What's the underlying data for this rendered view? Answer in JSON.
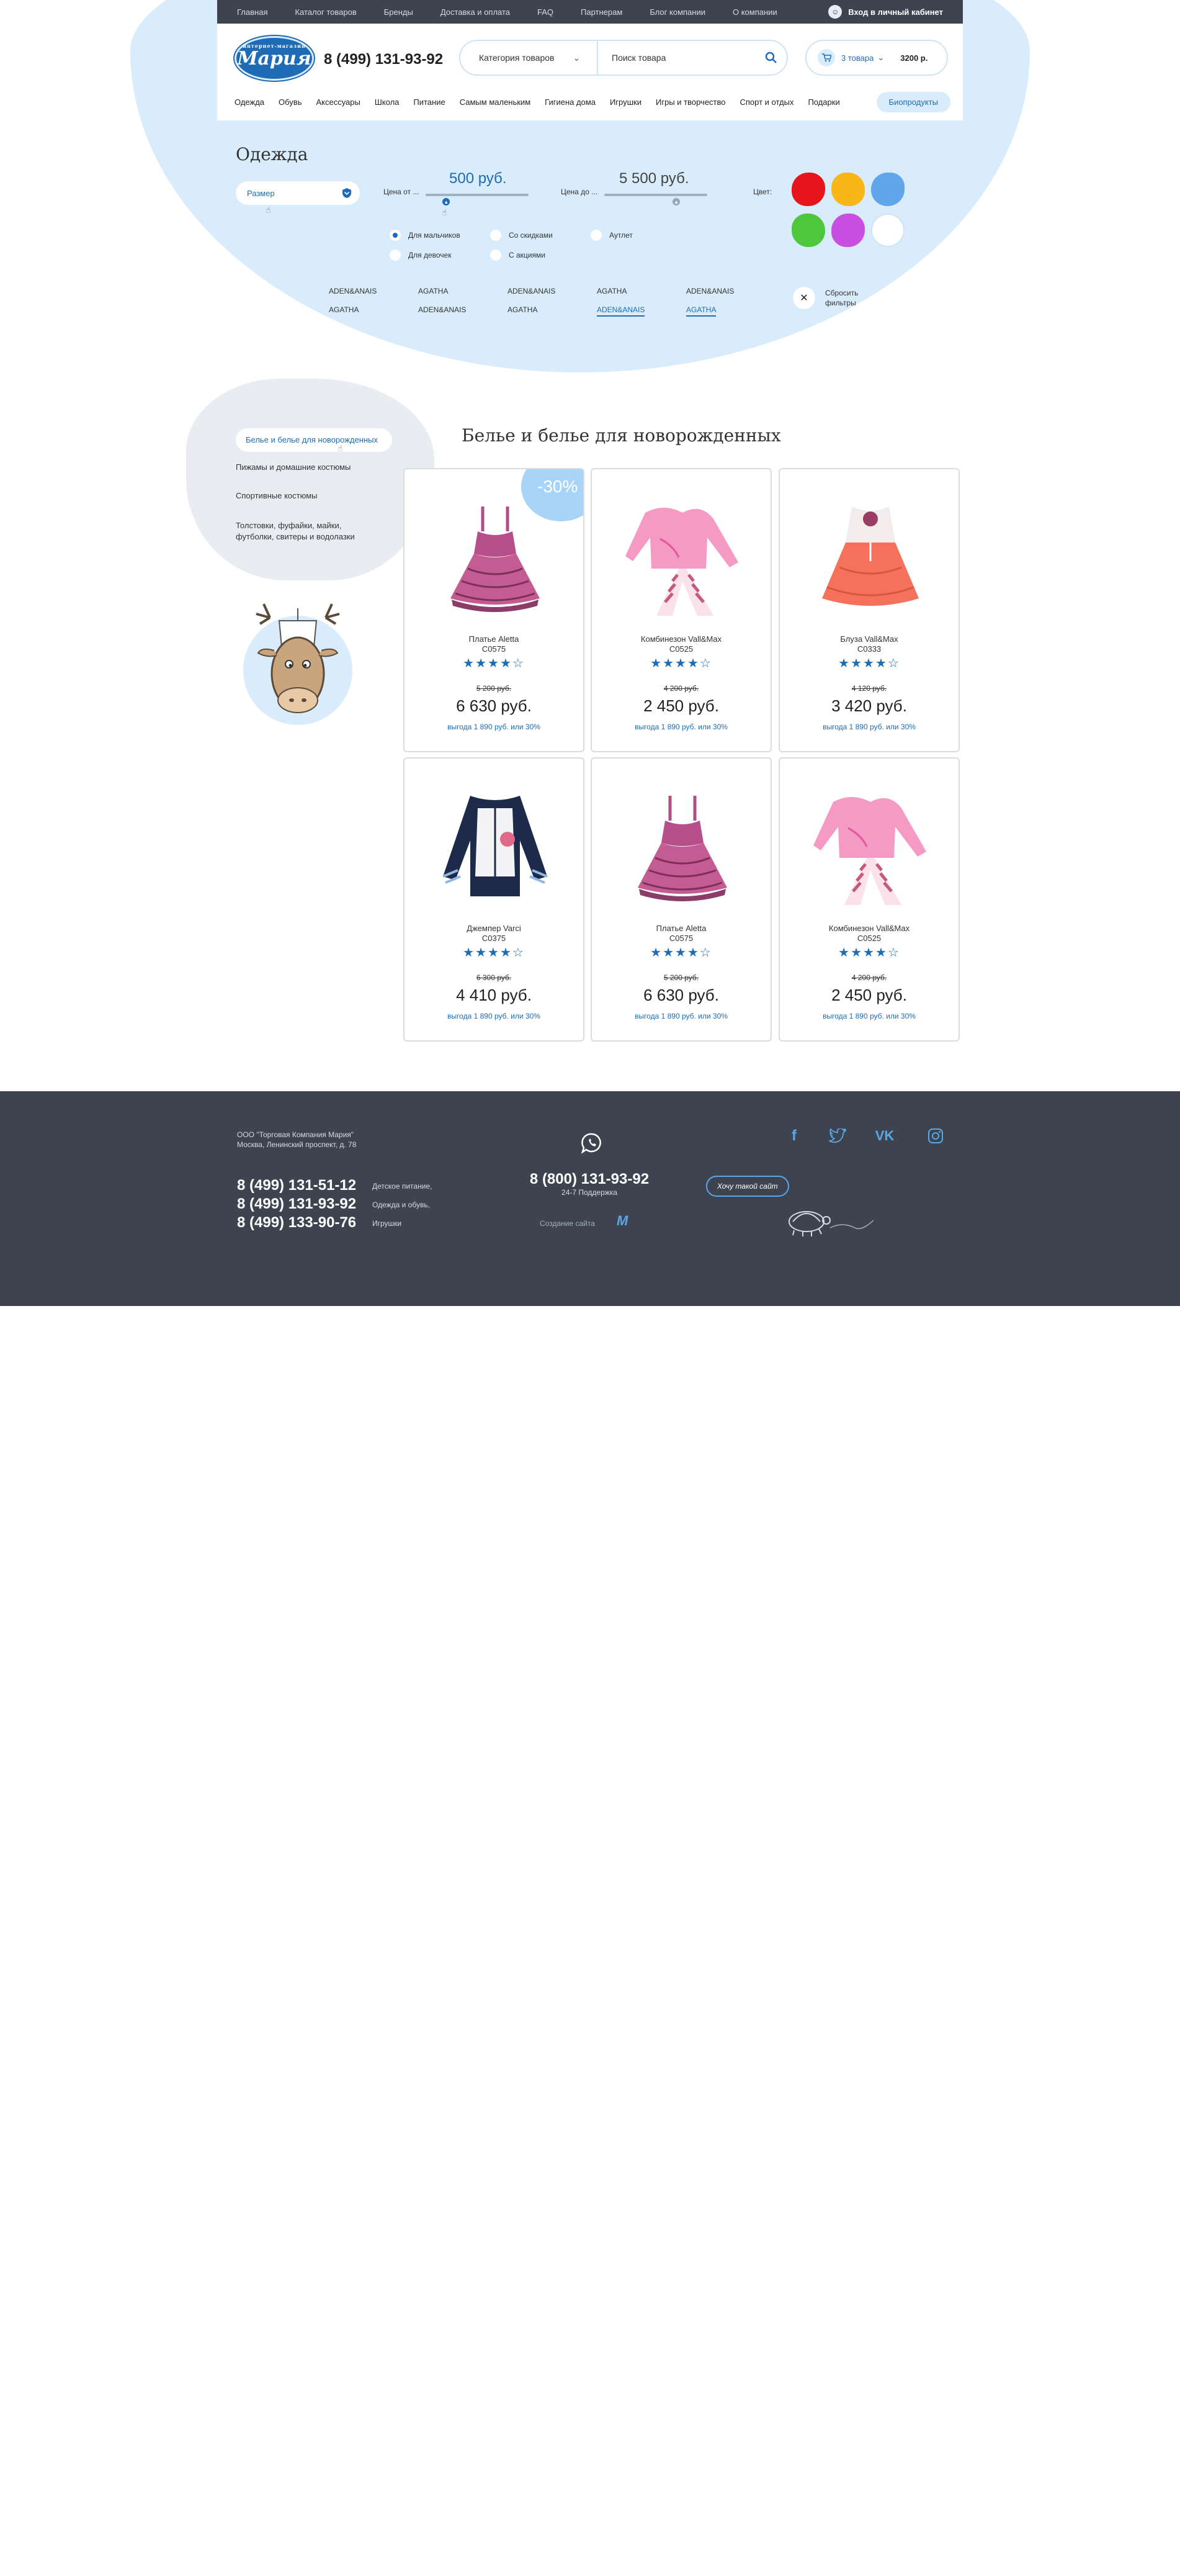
{
  "topbar": {
    "links": [
      "Главная",
      "Каталог товаров",
      "Бренды",
      "Доставка и оплата",
      "FAQ",
      "Партнерам",
      "Блог компании",
      "О компании"
    ],
    "login": "Вход в личный кабинет"
  },
  "header": {
    "logo_top": "интернет-магазин",
    "logo": "Мария",
    "phone": "8 (499) 131-93-92",
    "category_label": "Категория товаров",
    "search_placeholder": "Поиск товара",
    "cart_count": "3 товара",
    "cart_total": "3200 р."
  },
  "nav": {
    "items": [
      "Одежда",
      "Обувь",
      "Аксессуары",
      "Школа",
      "Питание",
      "Самым маленьким",
      "Гигиена дома",
      "Игрушки",
      "Игры и творчество",
      "Спорт и отдых",
      "Подарки"
    ],
    "bio": "Биопродукты"
  },
  "filters": {
    "title": "Одежда",
    "size_label": "Размер",
    "price_from_label": "Цена от ...",
    "price_from": "500 руб.",
    "price_from_level": 0.2,
    "price_to_label": "Цена до ...",
    "price_to": "5 500 руб.",
    "price_to_level": 0.7,
    "color_label": "Цвет:",
    "colors": [
      "#e8141b",
      "#f7b718",
      "#5fa6ea",
      "#4ec73d",
      "#c94fe0",
      "#ffffff"
    ],
    "radios": [
      {
        "label": "Для мальчиков",
        "checked": true
      },
      {
        "label": "Со скидками",
        "checked": false
      },
      {
        "label": "Аутлет",
        "checked": false
      },
      {
        "label": "Для девочек",
        "checked": false
      },
      {
        "label": "С акциями",
        "checked": false
      }
    ],
    "brands_row1": [
      "ADEN&ANAIS",
      "AGATHA",
      "ADEN&ANAIS",
      "AGATHA",
      "ADEN&ANAIS"
    ],
    "brands_row2": [
      "AGATHA",
      "ADEN&ANAIS",
      "AGATHA",
      "ADEN&ANAIS",
      "AGATHA"
    ],
    "reset_line1": "Сбросить",
    "reset_line2": "фильтры"
  },
  "sidebar": {
    "items": [
      "Белье и белье для новорожденных",
      "Пижамы и домашние костюмы",
      "Спортивные костюмы",
      "Толстовки, фуфайки, майки, футболки, свитеры и водолазки"
    ]
  },
  "products": {
    "title": "Белье и белье для новорожденных",
    "discount_label": "-30%",
    "items": [
      {
        "name": "Платье Aletta",
        "code": "C0575",
        "stars": "★★★★☆",
        "old_price": "5 200 руб.",
        "price": "6 630 руб.",
        "saving": "выгода 1 890 руб. или 30%",
        "type": "dress"
      },
      {
        "name": "Комбинезон Vall&Max",
        "code": "C0525",
        "stars": "★★★★☆",
        "old_price": "4 200 руб.",
        "price": "2 450 руб.",
        "saving": "выгода 1 890 руб. или 30%",
        "type": "pink-set"
      },
      {
        "name": "Блуза Vall&Max",
        "code": "C0333",
        "stars": "★★★★☆",
        "old_price": "4 120 руб.",
        "price": "3 420 руб.",
        "saving": "выгода 1 890 руб. или 30%",
        "type": "orange-dress"
      },
      {
        "name": "Джемпер Varci",
        "code": "C0375",
        "stars": "★★★★☆",
        "old_price": "6 300 руб.",
        "price": "4 410 руб.",
        "saving": "выгода 1 890 руб. или 30%",
        "type": "jacket"
      },
      {
        "name": "Платье Aletta",
        "code": "C0575",
        "stars": "★★★★☆",
        "old_price": "5 200 руб.",
        "price": "6 630 руб.",
        "saving": "выгода 1 890 руб. или 30%",
        "type": "dress"
      },
      {
        "name": "Комбинезон Vall&Max",
        "code": "C0525",
        "stars": "★★★★☆",
        "old_price": "4 200 руб.",
        "price": "2 450 руб.",
        "saving": "выгода 1 890 руб. или 30%",
        "type": "pink-set"
      }
    ]
  },
  "footer": {
    "company_line1": "ООО \"Торговая Компания Мария\"",
    "company_line2": "Москва, Ленинский проспект, д. 78",
    "phones": [
      {
        "number": "8 (499) 131-51-12",
        "label": "Детское питание,"
      },
      {
        "number": "8 (499) 131-93-92",
        "label": "Одежда и обувь,"
      },
      {
        "number": "8 (499) 133-90-76",
        "label": "Игрушки"
      }
    ],
    "free_phone": "8 (800) 131-93-92",
    "support": "24-7 Поддержка",
    "made_by": "Создание сайта",
    "want_same": "Хочу такой сайт",
    "socials": [
      "facebook-icon",
      "twitter-icon",
      "vk-icon",
      "instagram-icon"
    ]
  },
  "theme": {
    "accent": "#1d6cb5",
    "light": "#d9ecfb",
    "dark": "#3d4450"
  }
}
